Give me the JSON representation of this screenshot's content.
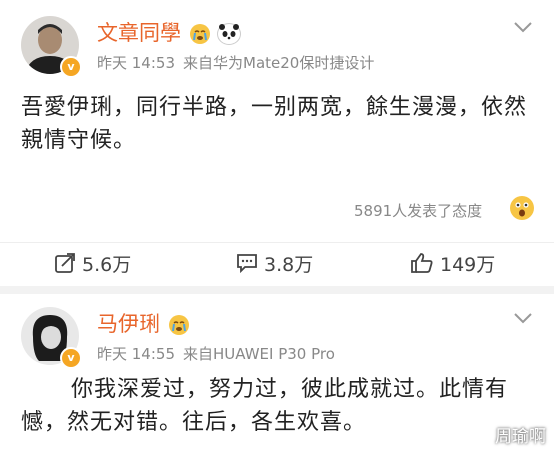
{
  "posts": [
    {
      "author": "文章同學",
      "time": "昨天 14:53",
      "source": "来自华为Mate20保时捷设计",
      "content": "吾愛伊琍，同行半路，一别两宽，餘生漫漫，依然親情守候。",
      "reactions_text": "5891人发表了态度",
      "actions": {
        "share": "5.6万",
        "comment": "3.8万",
        "like": "149万"
      }
    },
    {
      "author": "马伊琍",
      "time": "昨天 14:55",
      "source": "来自HUAWEI P30 Pro",
      "content": "你我深爱过，努力过，彼此成就过。此情有憾，然无对错。往后，各生欢喜。"
    }
  ],
  "watermark": "周瑜啊",
  "colors": {
    "name": "#e8652b",
    "meta": "#888888",
    "verified": "#f5a623"
  },
  "icons": [
    "crying-emoji-icon",
    "panda-emoji-icon",
    "verified-badge-icon",
    "chevron-down-icon",
    "surprised-emoji-icon",
    "share-icon",
    "comment-icon",
    "like-icon"
  ]
}
